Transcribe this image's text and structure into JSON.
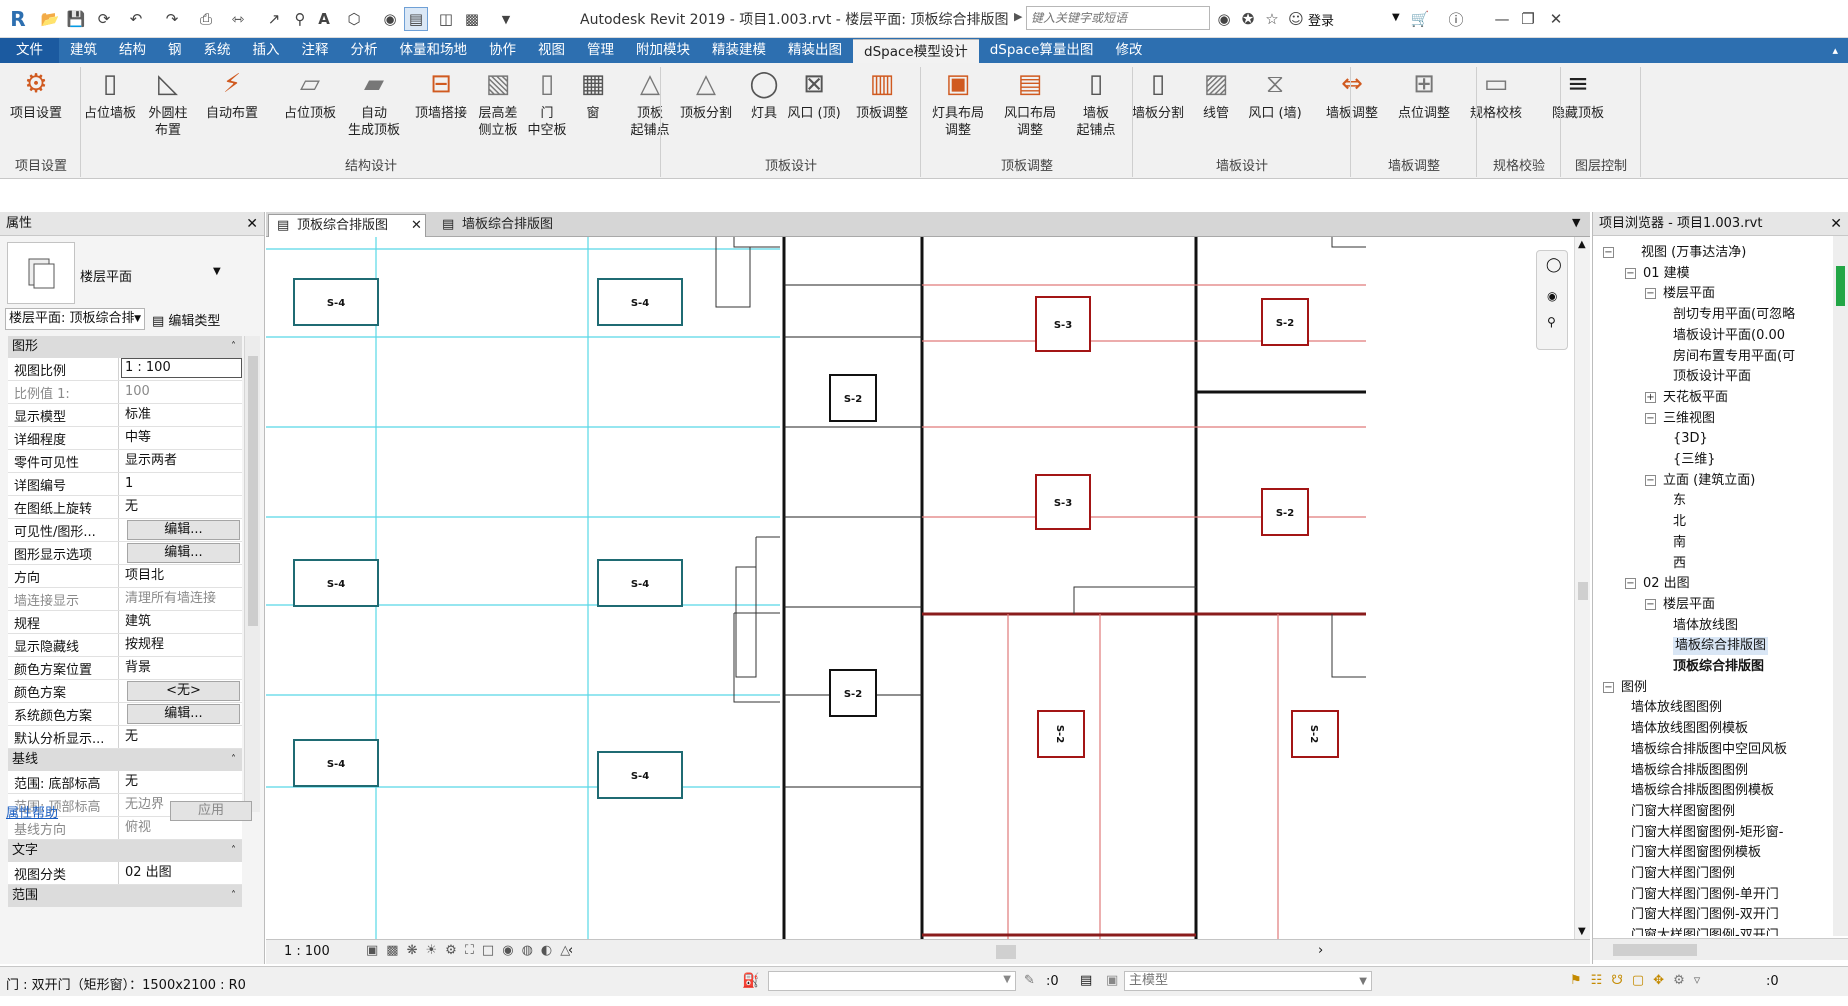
{
  "window": {
    "title": "Autodesk Revit 2019 - 项目1.003.rvt - 楼层平面: 顶板综合排版图",
    "search_placeholder": "键入关键字或短语",
    "login": "登录"
  },
  "menu": [
    "文件",
    "建筑",
    "结构",
    "钢",
    "系统",
    "插入",
    "注释",
    "分析",
    "体量和场地",
    "协作",
    "视图",
    "管理",
    "附加模块",
    "精装建模",
    "精装出图",
    "dSpace模型设计",
    "dSpace算量出图",
    "修改"
  ],
  "ribbon": {
    "buttons": [
      {
        "label": "项目设置",
        "icon": "gear-icon"
      },
      {
        "label": "占位墙板",
        "icon": "wall-panel-icon"
      },
      {
        "label": "外圆柱\n布置",
        "icon": "column-icon"
      },
      {
        "label": "自动布置",
        "icon": "auto-layout-icon"
      },
      {
        "label": "占位顶板",
        "icon": "ceiling-panel-icon"
      },
      {
        "label": "自动\n生成顶板",
        "icon": "auto-ceiling-icon"
      },
      {
        "label": "顶墙搭接",
        "icon": "joint-icon"
      },
      {
        "label": "层高差\n侧立板",
        "icon": "side-panel-icon"
      },
      {
        "label": "门\n中空板",
        "icon": "door-icon"
      },
      {
        "label": "窗",
        "icon": "window-icon"
      },
      {
        "label": "顶板\n起铺点",
        "icon": "start-point-icon"
      },
      {
        "label": "顶板分割",
        "icon": "split-icon"
      },
      {
        "label": "灯具",
        "icon": "lamp-icon"
      },
      {
        "label": "风口 (顶)",
        "icon": "vent-icon"
      },
      {
        "label": "顶板调整",
        "icon": "adjust-icon"
      },
      {
        "label": "灯具布局\n调整",
        "icon": "lamp-layout-icon"
      },
      {
        "label": "风口布局\n调整",
        "icon": "vent-layout-icon"
      },
      {
        "label": "墙板\n起铺点",
        "icon": "wall-start-icon"
      },
      {
        "label": "墙板分割",
        "icon": "wall-split-icon"
      },
      {
        "label": "线管",
        "icon": "conduit-icon"
      },
      {
        "label": "风口 (墙)",
        "icon": "wall-vent-icon"
      },
      {
        "label": "墙板调整",
        "icon": "wall-adjust-icon"
      },
      {
        "label": "点位调整",
        "icon": "point-adjust-icon"
      },
      {
        "label": "规格校核",
        "icon": "spec-check-icon"
      },
      {
        "label": "隐藏顶板",
        "icon": "layers-icon"
      }
    ],
    "groups": [
      "项目设置",
      "结构设计",
      "顶板设计",
      "顶板调整",
      "墙板设计",
      "墙板调整",
      "规格校验",
      "图层控制"
    ]
  },
  "properties": {
    "title": "属性",
    "type_name": "楼层平面",
    "selector": "楼层平面: 顶板综合排",
    "edit_type": "编辑类型",
    "sections": {
      "graphics": "图形",
      "underlay": "基线",
      "text": "文字",
      "extents": "范围"
    },
    "rows": [
      {
        "k": "视图比例",
        "v": "1 : 100",
        "style": "input"
      },
      {
        "k": "比例值 1:",
        "v": "100",
        "style": "gray"
      },
      {
        "k": "显示模型",
        "v": "标准"
      },
      {
        "k": "详细程度",
        "v": "中等"
      },
      {
        "k": "零件可见性",
        "v": "显示两者"
      },
      {
        "k": "详图编号",
        "v": "1"
      },
      {
        "k": "在图纸上旋转",
        "v": "无"
      },
      {
        "k": "可见性/图形...",
        "v": "编辑...",
        "style": "button"
      },
      {
        "k": "图形显示选项",
        "v": "编辑...",
        "style": "button"
      },
      {
        "k": "方向",
        "v": "项目北"
      },
      {
        "k": "墙连接显示",
        "v": "清理所有墙连接",
        "style": "gray"
      },
      {
        "k": "规程",
        "v": "建筑"
      },
      {
        "k": "显示隐藏线",
        "v": "按规程"
      },
      {
        "k": "颜色方案位置",
        "v": "背景"
      },
      {
        "k": "颜色方案",
        "v": "<无>",
        "style": "button"
      },
      {
        "k": "系统颜色方案",
        "v": "编辑...",
        "style": "button"
      },
      {
        "k": "默认分析显示...",
        "v": "无"
      }
    ],
    "underlay_rows": [
      {
        "k": "范围: 底部标高",
        "v": "无"
      },
      {
        "k": "范围: 顶部标高",
        "v": "无边界",
        "style": "gray"
      },
      {
        "k": "基线方向",
        "v": "俯视",
        "style": "gray"
      }
    ],
    "text_rows": [
      {
        "k": "视图分类",
        "v": "02 出图"
      }
    ],
    "help": "属性帮助",
    "apply": "应用"
  },
  "tabs": [
    {
      "label": "顶板综合排版图",
      "active": true
    },
    {
      "label": "墙板综合排版图",
      "active": false
    }
  ],
  "canvas": {
    "tags": [
      {
        "t": "S-4",
        "c": "#1f6b73"
      },
      {
        "t": "S-4",
        "c": "#1f6b73"
      },
      {
        "t": "S-4",
        "c": "#1f6b73"
      },
      {
        "t": "S-4",
        "c": "#1f6b73"
      },
      {
        "t": "S-4",
        "c": "#1f6b73"
      },
      {
        "t": "S-4",
        "c": "#1f6b73"
      },
      {
        "t": "S-2",
        "c": "#111"
      },
      {
        "t": "S-2",
        "c": "#111"
      },
      {
        "t": "S-3",
        "c": "#a31515"
      },
      {
        "t": "S-3",
        "c": "#a31515"
      },
      {
        "t": "S-2",
        "c": "#a31515"
      },
      {
        "t": "S-2",
        "c": "#a31515"
      },
      {
        "t": "S-2",
        "c": "#a31515"
      },
      {
        "t": "S-2",
        "c": "#a31515"
      }
    ],
    "scale": "1 : 100"
  },
  "browser": {
    "title": "项目浏览器 - 项目1.003.rvt",
    "nodes": [
      {
        "t": "视图 (万事达洁净)",
        "lvl": 0,
        "tog": "-"
      },
      {
        "t": "01 建模",
        "lvl": 1,
        "tog": "-"
      },
      {
        "t": "楼层平面",
        "lvl": 2,
        "tog": "-"
      },
      {
        "t": "剖切专用平面(可忽略",
        "lvl": 3
      },
      {
        "t": "墙板设计平面(0.00",
        "lvl": 3
      },
      {
        "t": "房间布置专用平面(可",
        "lvl": 3
      },
      {
        "t": "顶板设计平面",
        "lvl": 3
      },
      {
        "t": "天花板平面",
        "lvl": 2,
        "tog": "+"
      },
      {
        "t": "三维视图",
        "lvl": 2,
        "tog": "-"
      },
      {
        "t": "{3D}",
        "lvl": 3
      },
      {
        "t": "{三维}",
        "lvl": 3
      },
      {
        "t": "立面 (建筑立面)",
        "lvl": 2,
        "tog": "-"
      },
      {
        "t": "东",
        "lvl": 3
      },
      {
        "t": "北",
        "lvl": 3
      },
      {
        "t": "南",
        "lvl": 3
      },
      {
        "t": "西",
        "lvl": 3
      },
      {
        "t": "02 出图",
        "lvl": 1,
        "tog": "-"
      },
      {
        "t": "楼层平面",
        "lvl": 2,
        "tog": "-"
      },
      {
        "t": "墙体放线图",
        "lvl": 3
      },
      {
        "t": "墙板综合排版图",
        "lvl": 3,
        "sel": true
      },
      {
        "t": "顶板综合排版图",
        "lvl": 3,
        "bold": true
      },
      {
        "t": "图例",
        "lvl": 0,
        "tog": "-"
      },
      {
        "t": "墙体放线图图例",
        "lvl": 1
      },
      {
        "t": "墙体放线图图例模板",
        "lvl": 1
      },
      {
        "t": "墙板综合排版图中空回风板",
        "lvl": 1
      },
      {
        "t": "墙板综合排版图图例",
        "lvl": 1
      },
      {
        "t": "墙板综合排版图图例模板",
        "lvl": 1
      },
      {
        "t": "门窗大样图窗图例",
        "lvl": 1
      },
      {
        "t": "门窗大样图窗图例-矩形窗-",
        "lvl": 1
      },
      {
        "t": "门窗大样图窗图例模板",
        "lvl": 1
      },
      {
        "t": "门窗大样图门图例",
        "lvl": 1
      },
      {
        "t": "门窗大样图门图例-单开门",
        "lvl": 1
      },
      {
        "t": "门窗大样图门图例-双开门",
        "lvl": 1
      },
      {
        "t": "门窗大样图门图例-双开门",
        "lvl": 1
      }
    ]
  },
  "status": {
    "text": "门 : 双开门（矩形窗）：1500x2100 : R0",
    "zero1": ":0",
    "model": "主模型",
    "zero2": ":0"
  }
}
